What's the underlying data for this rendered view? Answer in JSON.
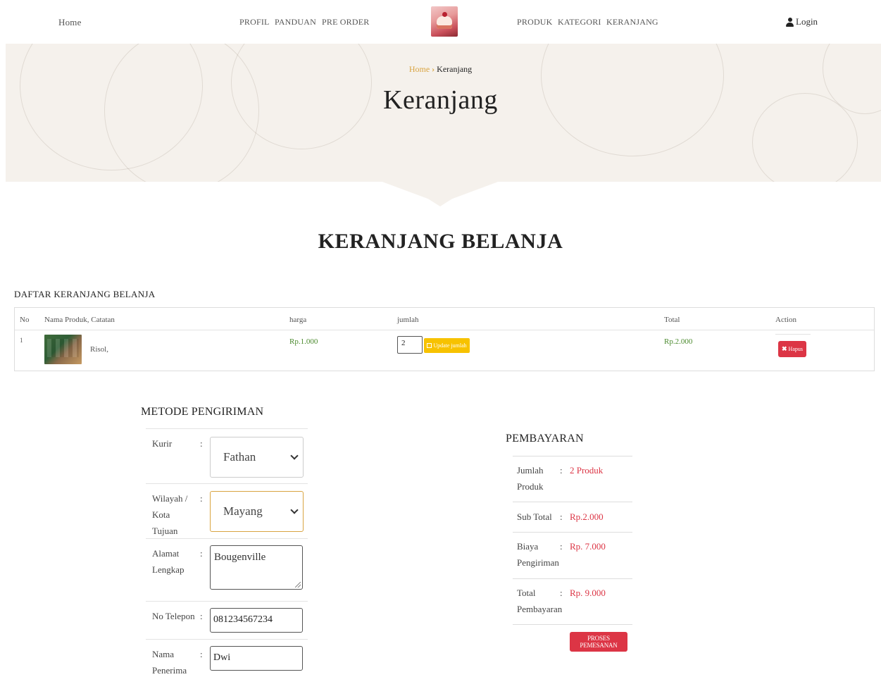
{
  "nav": {
    "home": "Home",
    "left_links": [
      "PROFIL",
      "PANDUAN",
      "PRE ORDER"
    ],
    "right_links": [
      "PRODUK",
      "KATEGORI",
      "KERANJANG"
    ],
    "login": "Login"
  },
  "hero": {
    "breadcrumb_home": "Home",
    "breadcrumb_current": "Keranjang",
    "title": "Keranjang"
  },
  "section_title": "KERANJANG BELANJA",
  "cart": {
    "title": "DAFTAR KERANJANG BELANJA",
    "headers": [
      "No",
      "Nama Produk, Catatan",
      "harga",
      "jumlah",
      "Total",
      "Action"
    ],
    "rows": [
      {
        "no": "1",
        "product": "Risol,",
        "price": "Rp.1.000",
        "qty": "2",
        "update_label": "Update jumlah",
        "total": "Rp.2.000",
        "delete_label": "Hapus"
      }
    ]
  },
  "shipping": {
    "title": "METODE PENGIRIMAN",
    "kurir_label": "Kurir",
    "kurir_value": "Fathan",
    "wilayah_label": "Wilayah / Kota Tujuan",
    "wilayah_value": "Mayang",
    "alamat_label": "Alamat Lengkap",
    "alamat_value": "Bougenville",
    "telepon_label": "No Telepon",
    "telepon_value": "081234567234",
    "penerima_label": "Nama Penerima",
    "penerima_value": "Dwi",
    "colon": ":"
  },
  "payment": {
    "title": "PEMBAYARAN",
    "jumlah_label": "Jumlah Produk",
    "jumlah_value": "2 Produk",
    "subtotal_label": "Sub Total",
    "subtotal_value": "Rp.2.000",
    "biaya_label": "Biaya Pengiriman",
    "biaya_value": "Rp. 7.000",
    "total_label": "Total Pembayaran",
    "total_value": "Rp. 9.000",
    "button": "PROSES PEMESANAN",
    "colon": ":"
  },
  "colors": {
    "accent_gold": "#d9a441",
    "danger_red": "#dc3545",
    "warning_yellow": "#f7c200",
    "price_green": "#4b8a2e",
    "hero_bg": "#f5f1ec"
  }
}
